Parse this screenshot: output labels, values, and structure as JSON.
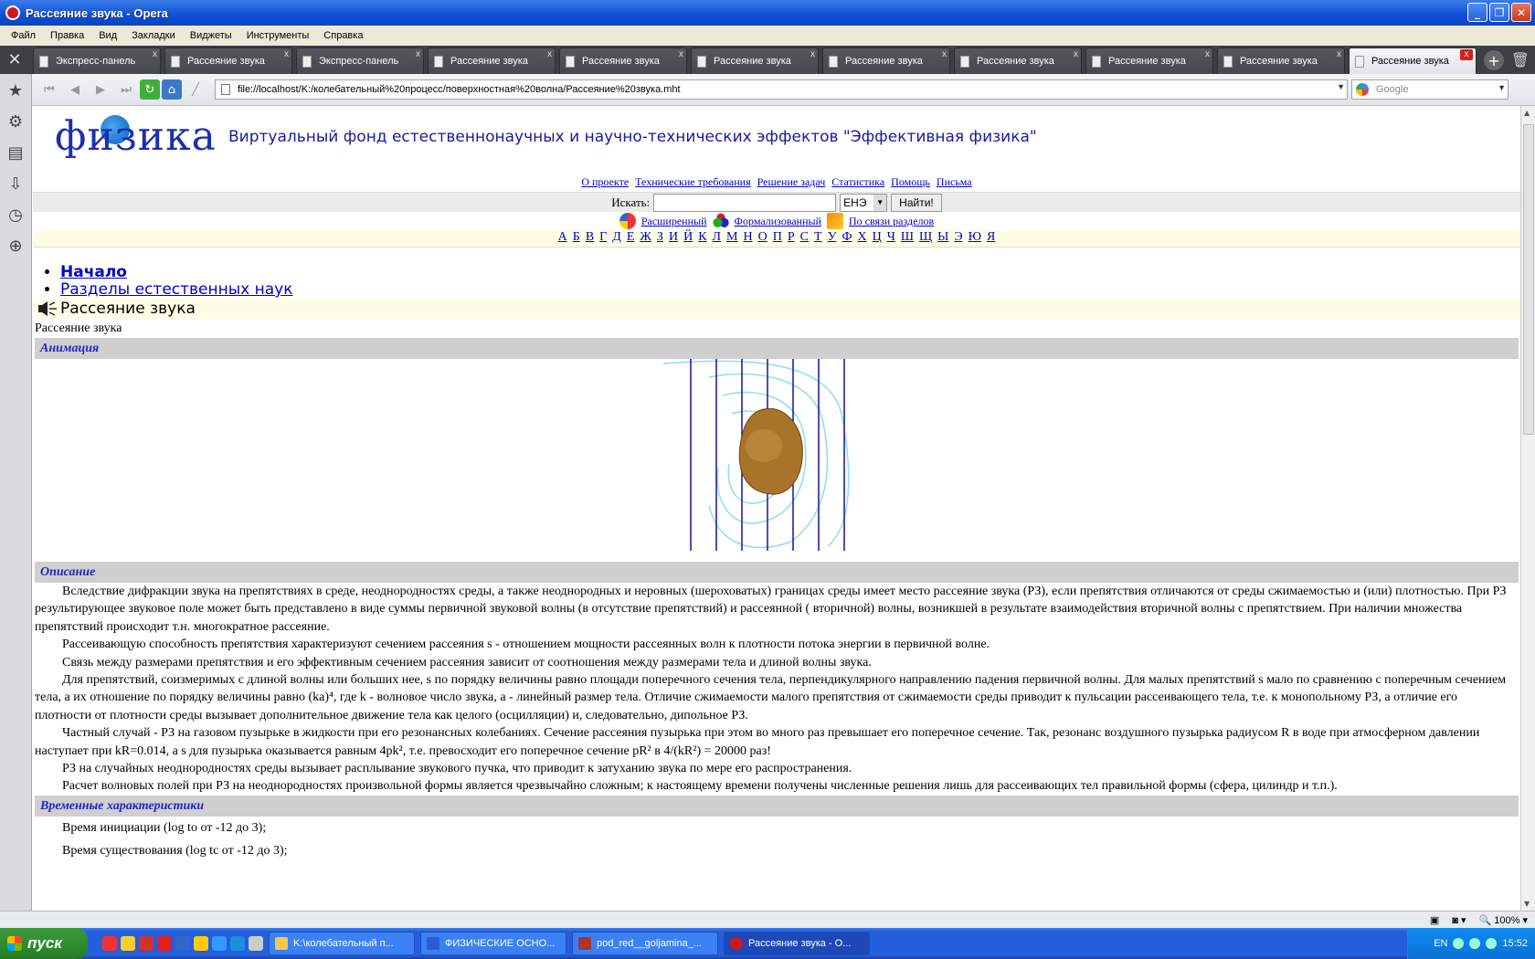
{
  "window": {
    "title": "Рассеяние звука - Opera"
  },
  "menu": [
    "Файл",
    "Правка",
    "Вид",
    "Закладки",
    "Виджеты",
    "Инструменты",
    "Справка"
  ],
  "tabs": [
    "Экспресс-панель",
    "Рассеяние звука",
    "Экспресс-панель",
    "Рассеяние звука",
    "Рассеяние звука",
    "Рассеяние звука",
    "Рассеяние звука",
    "Рассеяние звука",
    "Рассеяние звука",
    "Рассеяние звука",
    "Рассеяние звука"
  ],
  "address": {
    "url": "file://localhost/K:/колебательный%20процесс/поверхностная%20волна/Рассеяние%20звука.mht"
  },
  "search": {
    "placeholder": "Google"
  },
  "page": {
    "logo": "физика",
    "site_title": "Виртуальный фонд естественнонаучных и научно-технических эффектов \"Эффективная физика\"",
    "top_links": [
      "О проекте",
      "Технические требования",
      "Решение задач",
      "Статистика",
      "Помощь",
      "Письма"
    ],
    "search_label": "Искать:",
    "search_scope": "ЕНЭ",
    "search_button": "Найти!",
    "modes": [
      "Расширенный",
      "Формализованный",
      "По связи разделов"
    ],
    "alphabet": [
      "А",
      "Б",
      "В",
      "Г",
      "Д",
      "Е",
      "Ж",
      "З",
      "И",
      "Й",
      "К",
      "Л",
      "М",
      "Н",
      "О",
      "П",
      "Р",
      "С",
      "Т",
      "У",
      "Ф",
      "Х",
      "Ц",
      "Ч",
      "Ш",
      "Щ",
      "Ы",
      "Э",
      "Ю",
      "Я"
    ],
    "breadcrumbs": [
      "Начало",
      "Разделы естественных наук"
    ],
    "current_page": "Рассеяние звука",
    "subtitle": "Рассеяние звука",
    "section_animation": "Анимация",
    "section_description": "Описание",
    "paragraphs": [
      "Вследствие дифракции звука на препятствиях в среде, неоднородностях среды, а также неоднородных и неровных (шероховатых) границах среды имеет место рассеяние звука (РЗ), если препятствия отличаются от среды сжимаемостью и (или) плотностью. При РЗ результирующее звуковое поле может быть представлено в виде суммы первичной звуковой волны (в отсутствие препятствий) и рассеянной ( вторичной) волны, возникшей в результате взаимодействия вторичной волны с препятствием. При наличии множества препятствий происходит т.н. многократное рассеяние.",
      "Рассеивающую способность препятствия характеризуют сечением рассеяния s - отношением мощности рассеянных волн к плотности потока энергии в первичной волне.",
      "Связь между размерами препятствия и его эффективным сечением рассеяния зависит от соотношения между размерами тела и длиной волны звука.",
      "Для препятствий, соизмеримых с длиной волны или больших нее, s по порядку величины равно площади поперечного сечения тела, перпендикулярного направлению падения первичной волны. Для малых препятствий s мало по сравнению с поперечным сечением тела, а их отношение по порядку величины равно (ka)⁴, где k - волновое число звука, a - линейный размер тела. Отличие сжимаемости малого препятствия от сжимаемости среды приводит к пульсации рассеивающего тела, т.е. к монопольному РЗ, а отличие его плотности от плотности среды вызывает дополнительное движение тела как целого (осцилляции) и, следовательно, дипольное РЗ.",
      "Частный случай - РЗ на газовом пузырьке в жидкости при его резонансных колебаниях. Сечение рассеяния пузырька при этом во много раз превышает его поперечное сечение. Так, резонанс воздушного пузырька радиусом R в воде при атмосферном давлении наступает при kR=0.014, а s для пузырька оказывается равным 4pk², т.е. превосходит его поперечное сечение pR² в 4/(kR²) = 20000 раз!",
      "РЗ на случайных неоднородностях среды вызывает расплывание звукового пучка, что приводит к затуханию звука по мере его распространения.",
      "Расчет волновых полей при РЗ на неоднородностях произвольной формы является чрезвычайно сложным; к настоящему времени получены численные решения лишь для рассеивающих тел правильной формы (сфера, цилиндр и т.п.)."
    ],
    "section_time": "Временные характеристики",
    "time_lines": [
      "Время инициации (log tо от -12 до 3);",
      "Время существования (log tc от -12 до 3);"
    ]
  },
  "statusbar": {
    "zoom": "100%"
  },
  "taskbar": {
    "start": "пуск",
    "items": [
      "K:\\колебательный п...",
      "ФИЗИЧЕСКИЕ ОСНО...",
      "pod_red__goljamina_...",
      "Рассеяние звука - О..."
    ],
    "lang": "EN",
    "clock": "15:52"
  }
}
